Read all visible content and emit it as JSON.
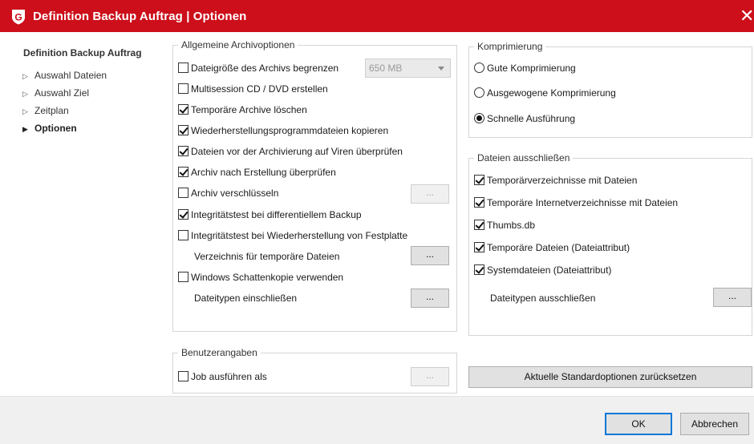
{
  "window": {
    "title": "Definition Backup Auftrag | Optionen",
    "close_glyph": "✕",
    "logo_letter": "G",
    "brand_color": "#cc0f1a"
  },
  "sidebar": {
    "heading": "Definition Backup Auftrag",
    "items": [
      {
        "label": "Auswahl Dateien",
        "active": false
      },
      {
        "label": "Auswahl Ziel",
        "active": false
      },
      {
        "label": "Zeitplan",
        "active": false
      },
      {
        "label": "Optionen",
        "active": true
      }
    ]
  },
  "general": {
    "title": "Allgemeine Archivoptionen",
    "size_limit": {
      "label": "Dateigröße des Archivs begrenzen",
      "checked": false,
      "select_value": "650 MB"
    },
    "multisession": {
      "label": "Multisession CD / DVD erstellen",
      "checked": false
    },
    "delete_temp": {
      "label": "Temporäre Archive löschen",
      "checked": true
    },
    "copy_restore": {
      "label": "Wiederherstellungsprogrammdateien kopieren",
      "checked": true
    },
    "virus_check": {
      "label": "Dateien vor der Archivierung auf Viren überprüfen",
      "checked": true
    },
    "verify": {
      "label": "Archiv nach Erstellung überprüfen",
      "checked": true
    },
    "encrypt": {
      "label": "Archiv verschlüsseln",
      "checked": false
    },
    "integrity_diff": {
      "label": "Integritätstest bei differentiellem Backup",
      "checked": true
    },
    "integrity_restore": {
      "label": "Integritätstest bei Wiederherstellung von Festplatte",
      "checked": false
    },
    "temp_dir_label": "Verzeichnis für temporäre Dateien",
    "shadow_copy": {
      "label": "Windows Schattenkopie verwenden",
      "checked": false
    },
    "include_types_label": "Dateitypen einschließen",
    "dots_label": "..."
  },
  "compression": {
    "title": "Komprimierung",
    "options": [
      {
        "label": "Gute Komprimierung",
        "selected": false
      },
      {
        "label": "Ausgewogene Komprimierung",
        "selected": false
      },
      {
        "label": "Schnelle Ausführung",
        "selected": true
      }
    ]
  },
  "exclude": {
    "title": "Dateien ausschließen",
    "items": [
      {
        "label": "Temporärverzeichnisse mit Dateien",
        "checked": true
      },
      {
        "label": "Temporäre Internetverzeichnisse mit Dateien",
        "checked": true
      },
      {
        "label": "Thumbs.db",
        "checked": true
      },
      {
        "label": "Temporäre Dateien (Dateiattribut)",
        "checked": true
      },
      {
        "label": "Systemdateien (Dateiattribut)",
        "checked": true
      }
    ],
    "exclude_types_label": "Dateitypen ausschließen"
  },
  "user": {
    "title": "Benutzerangaben",
    "run_as": {
      "label": "Job ausführen als",
      "checked": false
    }
  },
  "reset_label": "Aktuelle Standardoptionen zurücksetzen",
  "footer": {
    "ok_label": "OK",
    "cancel_label": "Abbrechen"
  }
}
